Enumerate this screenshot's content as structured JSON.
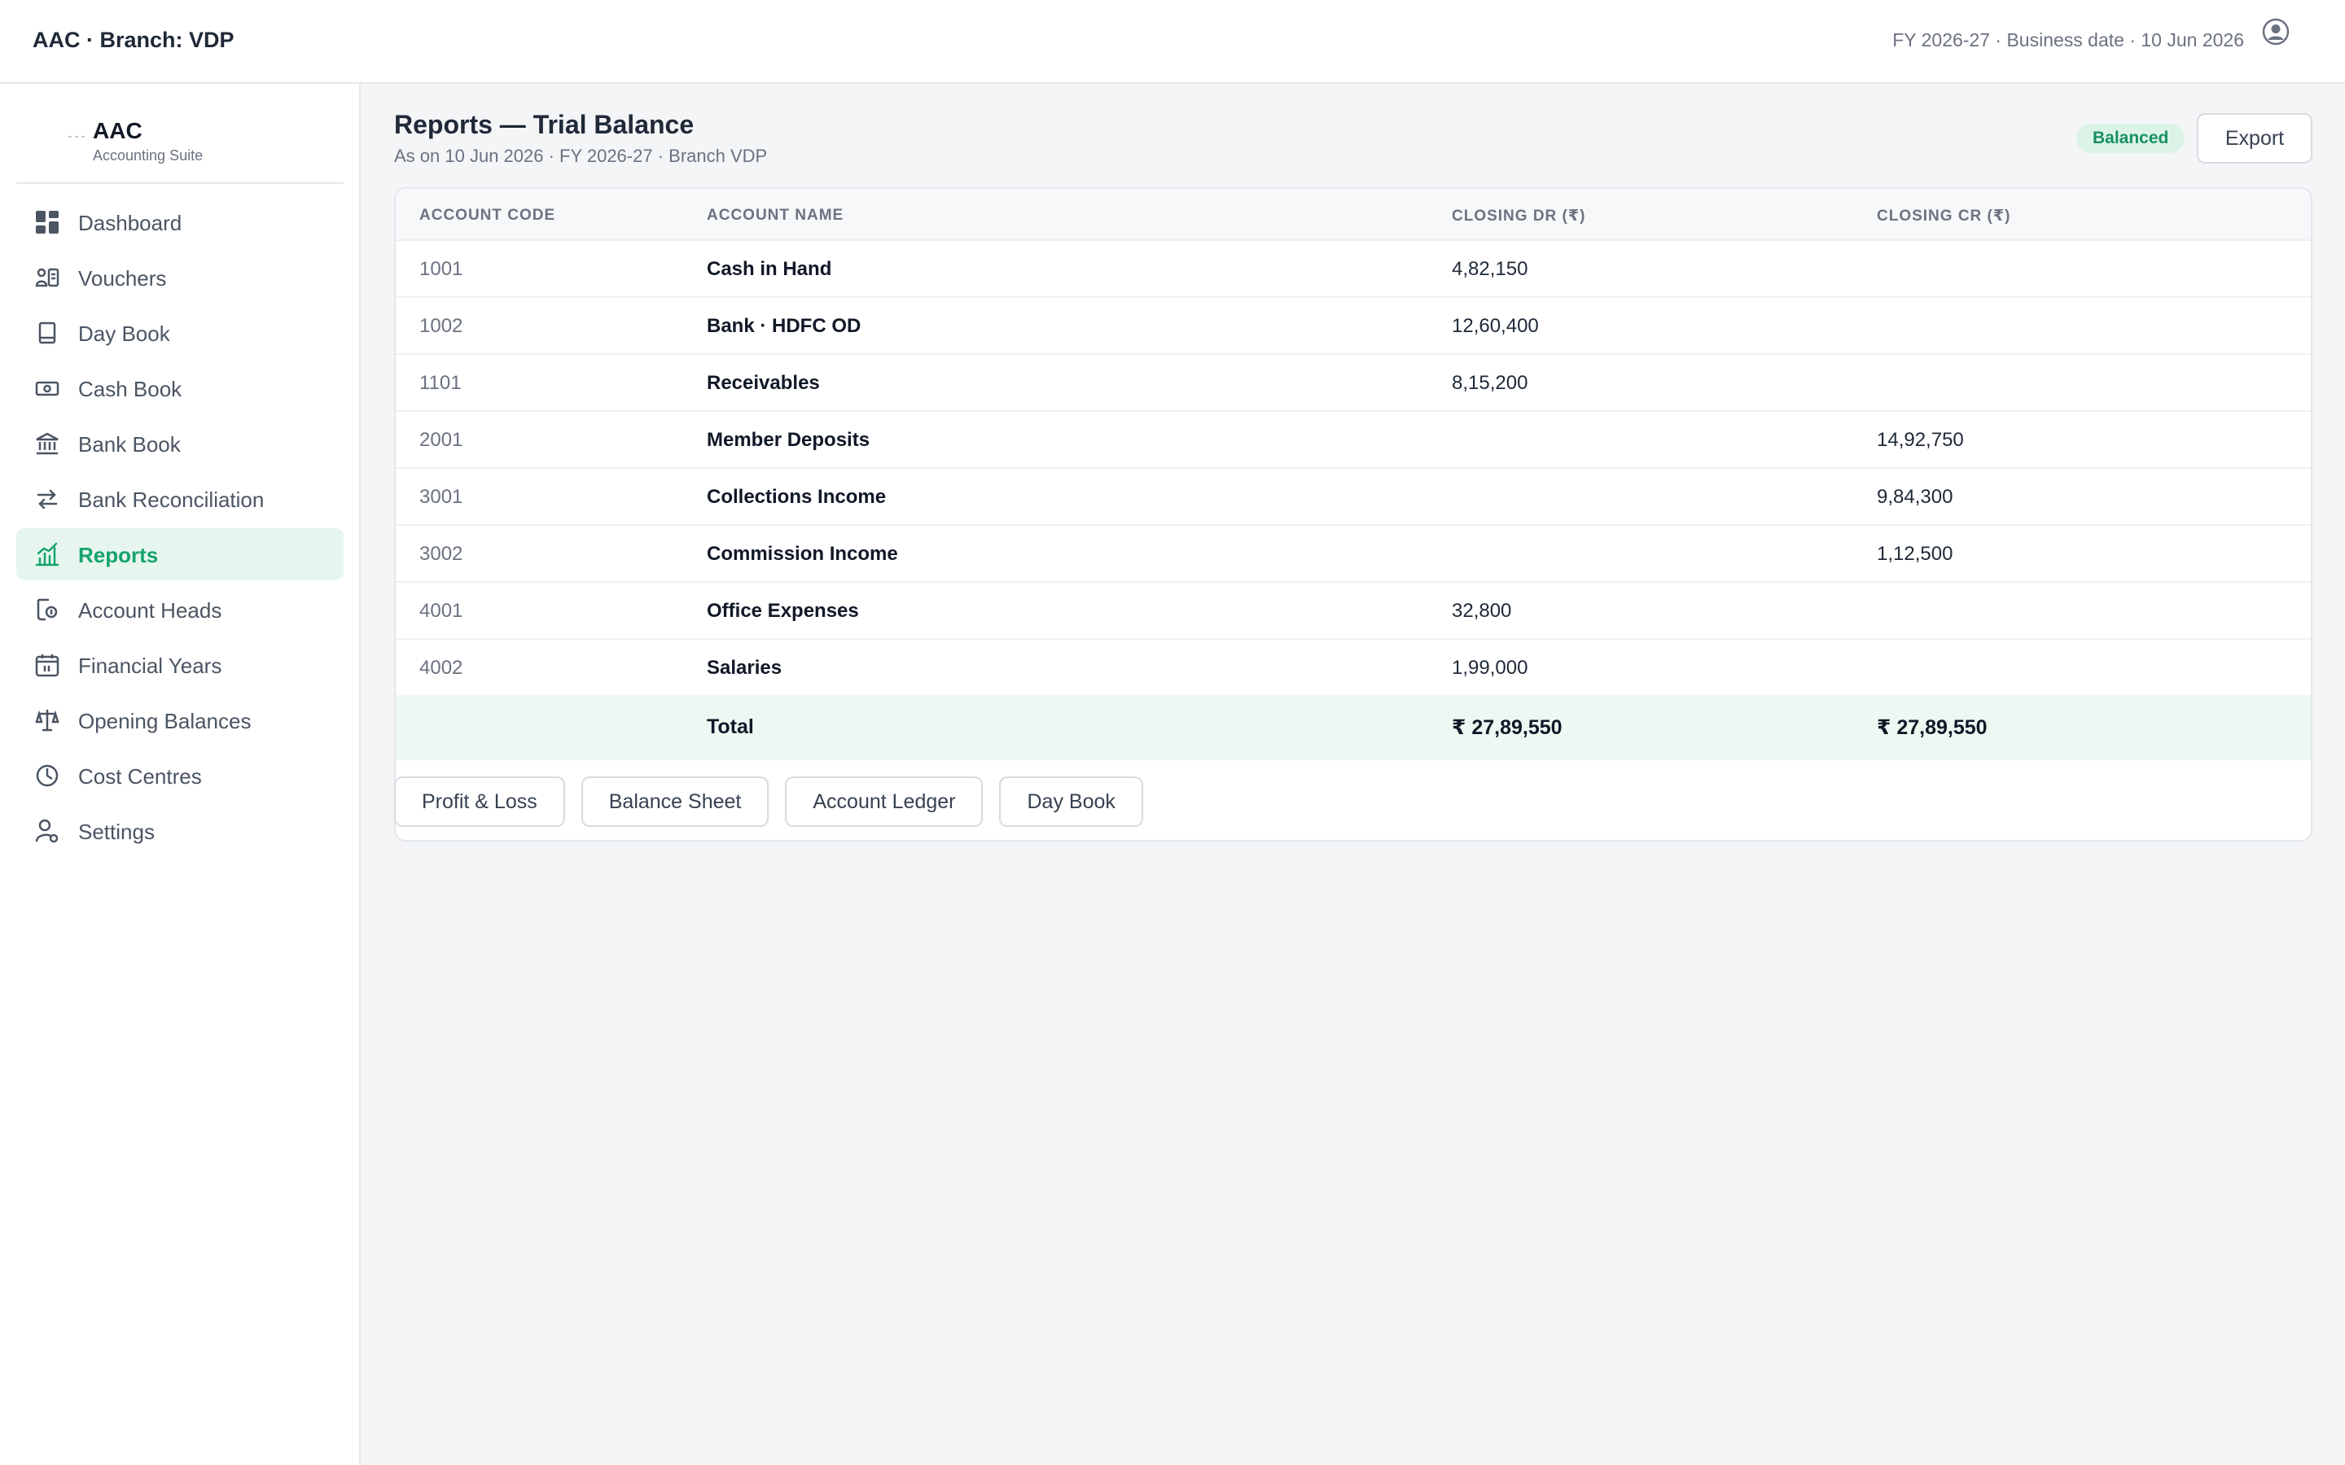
{
  "header": {
    "title": "AAC · Branch: VDP",
    "fy_info": "FY 2026-27 · Business date · 10 Jun 2026",
    "user_icon": "user-circle-icon"
  },
  "sidebar": {
    "brand": {
      "name": "AAC",
      "subtitle": "Accounting Suite"
    },
    "items": [
      {
        "label": "Dashboard",
        "icon": "dashboard-grid-icon",
        "active": false
      },
      {
        "label": "Vouchers",
        "icon": "voucher-icon",
        "active": false
      },
      {
        "label": "Day Book",
        "icon": "book-icon",
        "active": false
      },
      {
        "label": "Cash Book",
        "icon": "cash-icon",
        "active": false
      },
      {
        "label": "Bank Book",
        "icon": "bank-icon",
        "active": false
      },
      {
        "label": "Bank Reconciliation",
        "icon": "arrows-swap-icon",
        "active": false
      },
      {
        "label": "Reports",
        "icon": "bar-chart-icon",
        "active": true
      },
      {
        "label": "Account Heads",
        "icon": "account-heads-icon",
        "active": false
      },
      {
        "label": "Financial Years",
        "icon": "calendar-icon",
        "active": false
      },
      {
        "label": "Opening Balances",
        "icon": "scale-icon",
        "active": false
      },
      {
        "label": "Cost Centres",
        "icon": "pie-icon",
        "active": false
      },
      {
        "label": "Settings",
        "icon": "user-settings-icon",
        "active": false
      }
    ]
  },
  "page": {
    "title": "Reports — Trial Balance",
    "subtitle": "As on 10 Jun 2026 · FY 2026-27 · Branch VDP",
    "status_badge": "Balanced",
    "export_label": "Export"
  },
  "table": {
    "headers": {
      "code": "ACCOUNT CODE",
      "name": "ACCOUNT NAME",
      "dr": "CLOSING DR (₹)",
      "cr": "CLOSING CR (₹)"
    },
    "rows": [
      {
        "code": "1001",
        "name": "Cash in Hand",
        "dr": "4,82,150",
        "cr": ""
      },
      {
        "code": "1002",
        "name": "Bank · HDFC OD",
        "dr": "12,60,400",
        "cr": ""
      },
      {
        "code": "1101",
        "name": "Receivables",
        "dr": "8,15,200",
        "cr": ""
      },
      {
        "code": "2001",
        "name": "Member Deposits",
        "dr": "",
        "cr": "14,92,750"
      },
      {
        "code": "3001",
        "name": "Collections Income",
        "dr": "",
        "cr": "9,84,300"
      },
      {
        "code": "3002",
        "name": "Commission Income",
        "dr": "",
        "cr": "1,12,500"
      },
      {
        "code": "4001",
        "name": "Office Expenses",
        "dr": "32,800",
        "cr": ""
      },
      {
        "code": "4002",
        "name": "Salaries",
        "dr": "1,99,000",
        "cr": ""
      }
    ],
    "total": {
      "label": "Total",
      "dr": "₹ 27,89,550",
      "cr": "₹ 27,89,550"
    }
  },
  "quick_links": [
    "Profit & Loss",
    "Balance Sheet",
    "Account Ledger",
    "Day Book"
  ],
  "colors": {
    "accent": "#16a36a",
    "accent_bg": "#e6f6ef",
    "badge_bg": "#dcf3e8",
    "total_bg": "#eef8f3"
  }
}
